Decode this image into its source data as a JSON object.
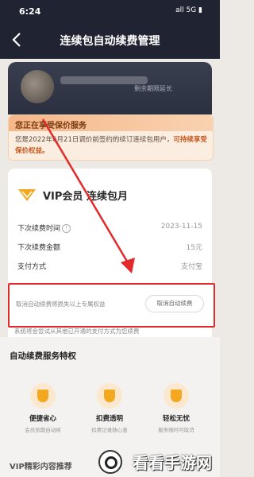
{
  "status_bar": {
    "time": "6:24",
    "right": "all 5G ▮"
  },
  "nav": {
    "title": "连续包自动续费管理"
  },
  "banner": {
    "text": "剩余期限延长"
  },
  "protect": {
    "heading": "您正在享受保价服务",
    "body_normal": "您是2022年6月21日调价前签约的续订连续包用户，",
    "body_bold": "可持续享受保价权益。"
  },
  "vip": {
    "title": "VIP会员  连续包月",
    "rows": [
      {
        "label": "下次续费时间",
        "value": "2023-11-15"
      },
      {
        "label": "下次续费金额",
        "value": "15元"
      },
      {
        "label": "支付方式",
        "value": "支付宝"
      }
    ]
  },
  "cancel": {
    "hint": "取消自动续费将损失以上专属权益",
    "button": "取消自动续费"
  },
  "footnote": "系统将会尝试从其他已开通的支付方式为您续费",
  "features": {
    "title": "自动续费服务特权",
    "items": [
      {
        "title": "便捷省心",
        "sub": "会员到期自动续"
      },
      {
        "title": "扣费透明",
        "sub": "扣费记录随心查"
      },
      {
        "title": "轻松无忧",
        "sub": "服务随时可取消"
      }
    ]
  },
  "bottom": {
    "title": "VIP精彩内容推荐"
  },
  "watermark": {
    "text": "看看手游网"
  },
  "colors": {
    "header": "#202432",
    "accent": "#f3a81f",
    "highlight_box": "#e22a2a"
  }
}
